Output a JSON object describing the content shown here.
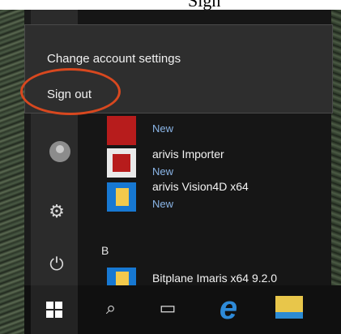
{
  "top_text": "Sign",
  "popup": {
    "change_account": "Change account settings",
    "sign_out": "Sign out"
  },
  "apps": [
    {
      "name": "",
      "status": "New"
    },
    {
      "name": "arivis Importer",
      "status": "New"
    },
    {
      "name": "arivis Vision4D x64",
      "status": "New"
    },
    {
      "name": "Bitplane Imaris x64 9.2.0",
      "status": ""
    }
  ],
  "section_letter": "B",
  "icons": {
    "settings": "gear-icon",
    "power": "power-icon",
    "search": "search-icon",
    "task_view": "task-view-icon",
    "edge": "edge-icon",
    "explorer": "file-explorer-icon",
    "start": "windows-start-icon"
  },
  "colors": {
    "highlight": "#d8481f",
    "accent": "#1778d2"
  }
}
